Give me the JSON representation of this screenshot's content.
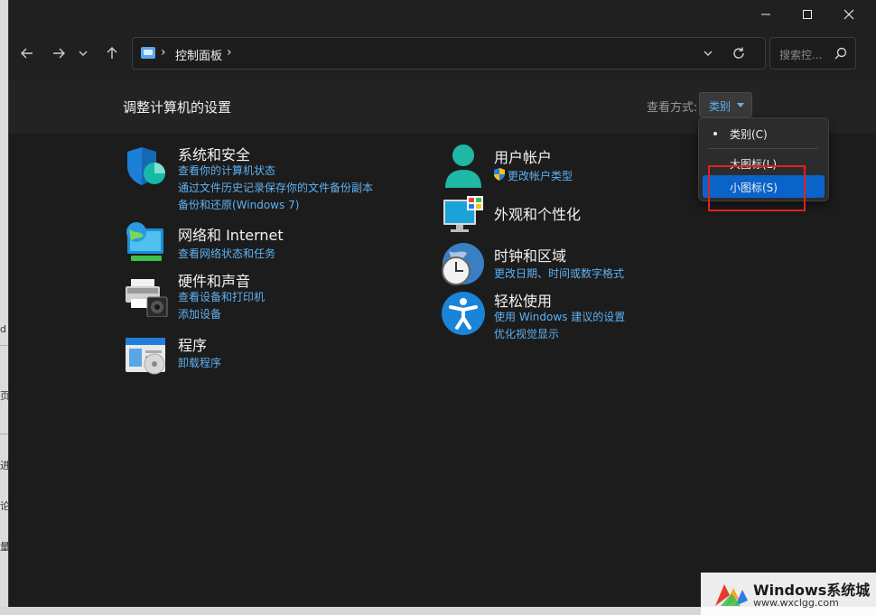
{
  "window": {
    "title_controls": {
      "minimize": "minimize-icon",
      "maximize": "maximize-icon",
      "close": "close-icon"
    }
  },
  "toolbar": {
    "back": "arrow-left-icon",
    "forward": "arrow-right-icon",
    "recent": "chevron-down-icon",
    "up": "arrow-up-icon",
    "address": {
      "crumb": "控制面板"
    },
    "search_placeholder": "搜索控..."
  },
  "header": {
    "title": "调整计算机的设置",
    "view_by_label": "查看方式:",
    "view_by_value": "类别"
  },
  "categories_left": [
    {
      "title": "系统和安全",
      "icon": "shield-icon",
      "links": [
        "查看你的计算机状态",
        "通过文件历史记录保存你的文件备份副本",
        "备份和还原(Windows 7)"
      ]
    },
    {
      "title": "网络和 Internet",
      "icon": "network-globe-icon",
      "links": [
        "查看网络状态和任务"
      ]
    },
    {
      "title": "硬件和声音",
      "icon": "printer-speaker-icon",
      "links": [
        "查看设备和打印机",
        "添加设备"
      ]
    },
    {
      "title": "程序",
      "icon": "programs-disc-icon",
      "links": [
        "卸载程序"
      ]
    }
  ],
  "categories_right": [
    {
      "title": "用户帐户",
      "icon": "user-icon",
      "links": [
        "更改帐户类型"
      ]
    },
    {
      "title": "外观和个性化",
      "icon": "monitor-icon",
      "links": []
    },
    {
      "title": "时钟和区域",
      "icon": "clock-globe-icon",
      "links": [
        "更改日期、时间或数字格式"
      ]
    },
    {
      "title": "轻松使用",
      "icon": "accessibility-icon",
      "links": [
        "使用 Windows 建议的设置",
        "优化视觉显示"
      ]
    }
  ],
  "view_menu": {
    "items": [
      {
        "label": "类别(C)",
        "selected": true
      },
      {
        "label": "大图标(L)",
        "selected": false
      },
      {
        "label": "小图标(S)",
        "selected": false,
        "hovered": true
      }
    ]
  },
  "watermark": {
    "title": "Windows系统城",
    "url": "www.wxclgg.com"
  },
  "background_fragments": [
    "d",
    "页",
    "进",
    "论",
    "量"
  ],
  "colors": {
    "accent": "#0a63c9",
    "link": "#5eb1f2",
    "highlight_box": "#e21f1f"
  }
}
